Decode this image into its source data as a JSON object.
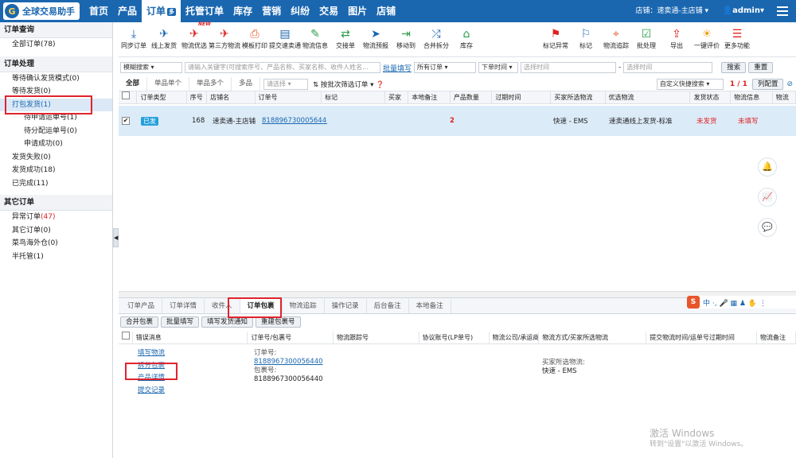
{
  "app": {
    "logo_text": "全球交易助手",
    "logo_glyph": "G"
  },
  "topnav": {
    "items": [
      "首页",
      "产品",
      "订单",
      "托管订单",
      "库存",
      "营销",
      "纠纷",
      "交易",
      "图片",
      "店铺"
    ],
    "active_badge": "多",
    "store_label": "店铺：",
    "store_name": "速卖通-主店铺",
    "user": "admin"
  },
  "sidebar": {
    "sections": [
      {
        "title": "订单查询",
        "items": [
          {
            "label": "全部订单(78)"
          }
        ]
      },
      {
        "title": "订单处理",
        "items": [
          {
            "label": "等待确认发货模式(0)"
          },
          {
            "label": "等待发货(0)"
          },
          {
            "label": "打包发货(1)"
          },
          {
            "label": "待申请运单号(1)"
          },
          {
            "label": "待分配运单号(0)"
          },
          {
            "label": "申请成功(0)"
          },
          {
            "label": "发货失败(0)"
          },
          {
            "label": "发货成功(18)"
          },
          {
            "label": "已完成(11)"
          }
        ]
      },
      {
        "title": "其它订单",
        "items": [
          {
            "label": "异常订单",
            "count": "(47)"
          },
          {
            "label": "其它订单(0)"
          },
          {
            "label": "菜鸟海外仓(0)"
          },
          {
            "label": "半托管(1)"
          }
        ]
      }
    ]
  },
  "toolbar": {
    "items": [
      {
        "label": "同步订单",
        "icon": "download-icon",
        "color": "#1a67b0"
      },
      {
        "label": "线上发货",
        "icon": "plane-icon",
        "color": "#1a67b0"
      },
      {
        "label": "物流优选",
        "icon": "plane-red-icon",
        "color": "#e02020",
        "new": "NEW"
      },
      {
        "label": "第三方物流",
        "icon": "plane-red-icon",
        "color": "#e02020"
      },
      {
        "label": "模板打印",
        "icon": "print-icon",
        "color": "#e8552a"
      },
      {
        "label": "提交速卖通",
        "icon": "document-icon",
        "color": "#1a67b0"
      },
      {
        "label": "物流信息",
        "icon": "pen-icon",
        "color": "#2a9d4a"
      },
      {
        "label": "交接单",
        "icon": "swap-icon",
        "color": "#2a9d4a"
      },
      {
        "label": "物流预报",
        "icon": "send-icon",
        "color": "#1a67b0"
      },
      {
        "label": "移动到",
        "icon": "move-icon",
        "color": "#2a9d4a"
      },
      {
        "label": "合并拆分",
        "icon": "shuffle-icon",
        "color": "#1a67b0"
      },
      {
        "label": "库存",
        "icon": "house-icon",
        "color": "#2a9d4a"
      },
      {
        "label": "标记异常",
        "icon": "flag-red-icon",
        "color": "#e02020"
      },
      {
        "label": "标记",
        "icon": "flag-icon",
        "color": "#1a67b0"
      },
      {
        "label": "物流追踪",
        "icon": "track-icon",
        "color": "#e8552a"
      },
      {
        "label": "批处理",
        "icon": "batch-icon",
        "color": "#2a9d4a"
      },
      {
        "label": "导出",
        "icon": "export-icon",
        "color": "#e02020"
      },
      {
        "label": "一键评价",
        "icon": "bulb-icon",
        "color": "#f0a020"
      },
      {
        "label": "更多功能",
        "icon": "menu-icon",
        "color": "#e02020"
      }
    ]
  },
  "filter": {
    "mode": "模糊搜索",
    "keyword_placeholder": "请输入关键字(可搜索序号、产品名称、买家名称、收件人姓名...",
    "batch_fill": "批量填写",
    "order_type": "所有订单",
    "time_type": "下单时间",
    "start_placeholder": "选择时间",
    "separator": "-",
    "end_placeholder": "选择时间",
    "search": "搜索",
    "reset": "重置"
  },
  "subtabs": {
    "items": [
      "全部",
      "单品单个",
      "单品多个",
      "多品"
    ],
    "select_placeholder": "请选择",
    "sort": "按批次筛选订单",
    "custom_search": "自定义快捷搜索",
    "page": "1 / 1",
    "config": "列配置"
  },
  "grid": {
    "headers": [
      "订单类型",
      "序号",
      "店铺名",
      "订单号",
      "标记",
      "买家",
      "本地备注",
      "产品数量",
      "过期时间",
      "买家所选物流",
      "优选物流",
      "发货状态",
      "物流信息",
      "物流"
    ],
    "row": {
      "type": "已发",
      "seq": "168",
      "store": "速卖通-主店铺",
      "order_no": "818896730005644(",
      "qty": "2",
      "buyer_logistics": "快速 - EMS",
      "preferred_logistics": "速卖通线上发货-标准",
      "ship_status": "未发货",
      "logistics_info": "未填写"
    }
  },
  "bottom": {
    "tabs": [
      "订单产品",
      "订单详情",
      "收件人",
      "订单包裹",
      "物流追踪",
      "操作记录",
      "后台备注",
      "本地备注"
    ],
    "actions": [
      "合并包裹",
      "批量填写",
      "填写发货通知",
      "重建包裹号"
    ],
    "headers": [
      "错误消息",
      "订单号/包裹号",
      "物流跟踪号",
      "协议账号(LP单号)",
      "物流公司/承运商",
      "物流方式/买家所选物流",
      "提交物流时间/运单号过期时间",
      "物流备注"
    ],
    "links": [
      "填写物流",
      "拆分包裹",
      "产品详情",
      "提交记录"
    ],
    "order_label": "订单号:",
    "order_no": "8188967300056440",
    "package_label": "包裹号:",
    "package_no": "8188967300056440",
    "buyer_logistics_label": "买家所选物流:",
    "buyer_logistics": "快速 - EMS"
  },
  "ime": {
    "logo": "S",
    "text": "中 ·, 🎤 ▦ ♟ ✋ ⋮"
  },
  "watermark": {
    "line1": "激活 Windows",
    "line2": "转到\"设置\"以激活 Windows。"
  }
}
